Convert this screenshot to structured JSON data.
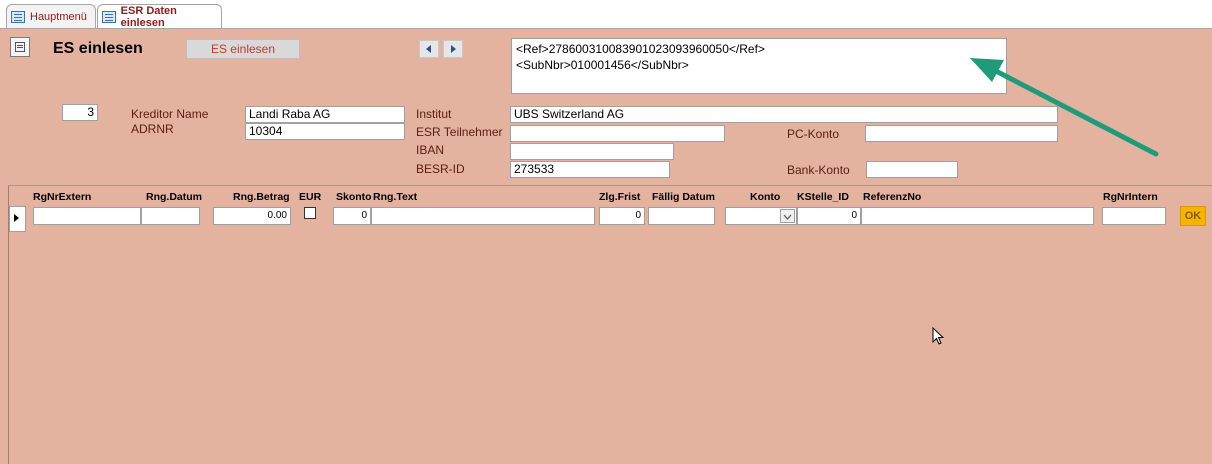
{
  "tabs": [
    {
      "label": "Hauptmenü"
    },
    {
      "label": "ESR Daten einlesen"
    }
  ],
  "form": {
    "title": "ES einlesen",
    "es_button": "ES einlesen",
    "xml_lines": [
      "<Ref>278600310083901023093960050</Ref>",
      "<SubNbr>010001456</SubNbr>"
    ],
    "record_number": "3",
    "labels": {
      "kreditor_name": "Kreditor Name",
      "adrnr": "ADRNR",
      "institut": "Institut",
      "esr_teilnehmer": "ESR Teilnehmer",
      "iban": "IBAN",
      "besr_id": "BESR-ID",
      "pc_konto": "PC-Konto",
      "bank_konto": "Bank-Konto"
    },
    "values": {
      "kreditor_name": "Landi Raba AG",
      "adrnr": "10304",
      "institut": "UBS Switzerland AG",
      "esr_teilnehmer": "",
      "iban": "",
      "besr_id": "273533",
      "pc_konto": "",
      "bank_konto": ""
    }
  },
  "grid": {
    "columns": [
      "RgNrExtern",
      "Rng.Datum",
      "Rng.Betrag",
      "EUR",
      "Skonto",
      "Rng.Text",
      "Zlg.Frist",
      "Fällig Datum",
      "Konto",
      "KStelle_ID",
      "ReferenzNo",
      "RgNrIntern"
    ],
    "row": {
      "rgnr_extern": "",
      "rng_datum": "",
      "rng_betrag": "0.00",
      "eur": false,
      "skonto": "0",
      "rng_text": "",
      "zlg_frist": "0",
      "faellig_datum": "",
      "konto": "",
      "kstelle_id": "0",
      "referenz_no": "",
      "rgnr_intern": ""
    },
    "ok_button": "OK"
  },
  "colors": {
    "form_background": "#e3b3a0",
    "arrow": "#1e9c7a",
    "ok_button": "#f5b400"
  }
}
